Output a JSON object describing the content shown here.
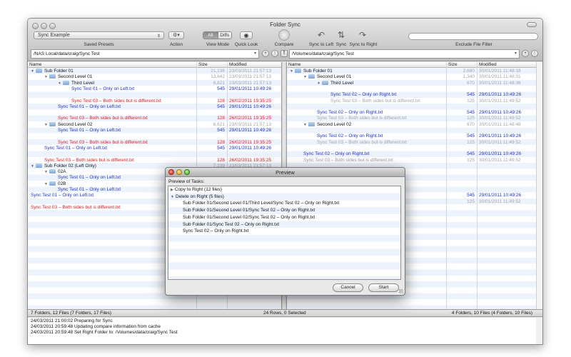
{
  "window": {
    "title": "Folder Sync"
  },
  "toolbar": {
    "preset_value": "Sync Example",
    "saved_presets_label": "Saved Presets",
    "action_label": "Action",
    "view_mode_label": "View Mode",
    "view_all": "All",
    "view_diffs": "Diffs",
    "quick_look_label": "Quick Look",
    "compare_label": "Compare",
    "sync_left_label": "Sync to Left",
    "sync_label": "Sync",
    "sync_right_label": "Sync to Right",
    "exclude_filter_label": "Exclude File Filter"
  },
  "left": {
    "path": "/NAS Local/data/craig/Sync Test",
    "col_name": "Name",
    "col_size": "Size",
    "col_modified": "Modified",
    "rows": [
      {
        "name": "Sub Folder 01",
        "size": "21,136",
        "mod": "23/03/2011 21:57:13",
        "indent": 0,
        "folder": true,
        "tri": "▼",
        "color": "c-black",
        "meta": "c-gray"
      },
      {
        "name": "Second Level 01",
        "size": "13,642",
        "mod": "23/03/2011 21:57:13",
        "indent": 1,
        "folder": true,
        "tri": "▼",
        "color": "c-black",
        "meta": "c-gray"
      },
      {
        "name": "Third Level",
        "size": "6,821",
        "mod": "23/03/2011 21:57:13",
        "indent": 2,
        "folder": true,
        "tri": "▼",
        "color": "c-black",
        "meta": "c-gray"
      },
      {
        "name": "Sync Test 01 – Only on Left.txt",
        "size": "545",
        "mod": "29/01/2011 10:49:26",
        "indent": 3,
        "color": "c-blue",
        "meta": "c-blue"
      },
      {
        "name": "",
        "size": "",
        "mod": "",
        "indent": 0
      },
      {
        "name": "Sync Test 03 – Both sides but is different.txt",
        "size": "128",
        "mod": "26/02/2011 19:35:25",
        "indent": 3,
        "color": "c-red",
        "meta": "c-red"
      },
      {
        "name": "Sync Test 01 – Only on Left.txt",
        "size": "545",
        "mod": "29/01/2011 10:49:26",
        "indent": 2,
        "color": "c-blue",
        "meta": "c-blue"
      },
      {
        "name": "",
        "size": "",
        "mod": "",
        "indent": 0
      },
      {
        "name": "Sync Test 03 – Both sides but is different.txt",
        "size": "128",
        "mod": "26/02/2011 19:35:25",
        "indent": 2,
        "color": "c-red",
        "meta": "c-red"
      },
      {
        "name": "Second Level 02",
        "size": "6,621",
        "mod": "23/03/2011 21:57:13",
        "indent": 1,
        "folder": true,
        "tri": "▼",
        "color": "c-black",
        "meta": "c-gray"
      },
      {
        "name": "Sync Test 01 – Only on Left.txt",
        "size": "545",
        "mod": "29/01/2011 10:49:26",
        "indent": 2,
        "color": "c-blue",
        "meta": "c-blue"
      },
      {
        "name": "",
        "size": "",
        "mod": "",
        "indent": 0
      },
      {
        "name": "Sync Test 03 – Both sides but is different.txt",
        "size": "128",
        "mod": "26/02/2011 19:35:25",
        "indent": 2,
        "color": "c-red",
        "meta": "c-red"
      },
      {
        "name": "Sync Test 01 – Only on Left.txt",
        "size": "545",
        "mod": "29/01/2011 10:49:26",
        "indent": 1,
        "color": "c-blue",
        "meta": "c-blue"
      },
      {
        "name": "",
        "size": "",
        "mod": "",
        "indent": 0
      },
      {
        "name": "Sync Test 03 – Both sides but is different.txt",
        "size": "128",
        "mod": "26/02/2011 19:35:25",
        "indent": 1,
        "color": "c-red",
        "meta": "c-red"
      },
      {
        "name": "Sub Folder 02 (Left Only)",
        "size": "7,239",
        "mod": "23/03/2011 21:57:13",
        "indent": 0,
        "folder": true,
        "tri": "▼",
        "color": "c-black",
        "meta": "c-gray"
      },
      {
        "name": "02A",
        "size": "",
        "mod": "",
        "indent": 1,
        "folder": true,
        "tri": "▼",
        "color": "c-black"
      },
      {
        "name": "Sync Test 01 – Only on Left.txt",
        "size": "",
        "mod": "",
        "indent": 2,
        "color": "c-blue"
      },
      {
        "name": "02B",
        "size": "",
        "mod": "",
        "indent": 1,
        "folder": true,
        "tri": "▼",
        "color": "c-black"
      },
      {
        "name": "Sync Test 01 – Only on Left.txt",
        "size": "",
        "mod": "",
        "indent": 2,
        "color": "c-blue"
      },
      {
        "name": "Sync Test 01 – Only on Left.txt",
        "size": "",
        "mod": "",
        "indent": 0,
        "color": "c-blue"
      },
      {
        "name": "",
        "size": "",
        "mod": "",
        "indent": 0
      },
      {
        "name": "Sync Test 03 – Both sides but is different.txt",
        "size": "",
        "mod": "",
        "indent": 0,
        "color": "c-red"
      }
    ]
  },
  "right": {
    "path": "/Volumes/data/craig/Sync Test",
    "col_name": "Name",
    "col_size": "Size",
    "col_modified": "Modified",
    "rows": [
      {
        "name": "Sub Folder 01",
        "size": "2,680",
        "mod": "30/01/2011 11:48:18",
        "indent": 0,
        "folder": true,
        "tri": "▼",
        "color": "c-black",
        "meta": "c-gray"
      },
      {
        "name": "Second Level 01",
        "size": "1,340",
        "mod": "30/01/2011 11:48:31",
        "indent": 1,
        "folder": true,
        "tri": "▼",
        "color": "c-black",
        "meta": "c-gray"
      },
      {
        "name": "Third Level",
        "size": "670",
        "mod": "30/01/2011 11:48:36",
        "indent": 2,
        "folder": true,
        "tri": "▼",
        "color": "c-black",
        "meta": "c-gray"
      },
      {
        "name": "",
        "size": "",
        "mod": "",
        "indent": 0
      },
      {
        "name": "Sync Test 02 – Only on Right.txt",
        "size": "545",
        "mod": "29/01/2011 10:49:26",
        "indent": 3,
        "color": "c-blue",
        "meta": "c-blue"
      },
      {
        "name": "Sync Test 03 – Both sides but is different.txt",
        "size": "125",
        "mod": "30/01/2011 11:49:52",
        "indent": 3,
        "color": "c-gray",
        "meta": "c-gray"
      },
      {
        "name": "",
        "size": "",
        "mod": "",
        "indent": 0
      },
      {
        "name": "Sync Test 02 – Only on Right.txt",
        "size": "545",
        "mod": "29/01/2011 10:49:26",
        "indent": 2,
        "color": "c-blue",
        "meta": "c-blue"
      },
      {
        "name": "Sync Test 03 – Both sides but is different.txt",
        "size": "125",
        "mod": "30/01/2011 11:49:52",
        "indent": 2,
        "color": "c-gray",
        "meta": "c-gray"
      },
      {
        "name": "Second Level 02",
        "size": "670",
        "mod": "30/01/2011 11:48:48",
        "indent": 1,
        "folder": true,
        "tri": "▼",
        "color": "c-black",
        "meta": "c-gray"
      },
      {
        "name": "",
        "size": "",
        "mod": "",
        "indent": 0
      },
      {
        "name": "Sync Test 02 – Only on Right.txt",
        "size": "545",
        "mod": "29/01/2011 10:49:26",
        "indent": 2,
        "color": "c-blue",
        "meta": "c-blue"
      },
      {
        "name": "Sync Test 03 – Both sides but is different.txt",
        "size": "125",
        "mod": "30/01/2011 11:49:52",
        "indent": 2,
        "color": "c-gray",
        "meta": "c-gray"
      },
      {
        "name": "",
        "size": "",
        "mod": "",
        "indent": 0
      },
      {
        "name": "Sync Test 02 – Only on Right.txt",
        "size": "545",
        "mod": "29/01/2011 10:49:26",
        "indent": 1,
        "color": "c-blue",
        "meta": "c-blue"
      },
      {
        "name": "Sync Test 03 – Both sides but is different.txt",
        "size": "125",
        "mod": "30/01/2011 11:49:52",
        "indent": 1,
        "color": "c-gray",
        "meta": "c-gray"
      },
      {
        "name": "",
        "size": "",
        "mod": "",
        "indent": 0
      },
      {
        "name": "",
        "size": "",
        "mod": "",
        "indent": 0
      },
      {
        "name": "",
        "size": "",
        "mod": "",
        "indent": 0
      },
      {
        "name": "",
        "size": "",
        "mod": "",
        "indent": 0
      },
      {
        "name": "",
        "size": "",
        "mod": "",
        "indent": 0
      },
      {
        "name": "",
        "size": "545",
        "mod": "29/01/2011 10:49:26",
        "indent": 0,
        "color": "c-blue",
        "meta": "c-blue"
      },
      {
        "name": "",
        "size": "125",
        "mod": "30/01/2011 11:49:52",
        "indent": 0,
        "color": "c-gray",
        "meta": "c-gray"
      }
    ]
  },
  "status": {
    "left": "7 Folders, 12 Files (7 Folders, 17 Files)",
    "center": "24 Rows, 0 Selected",
    "right": "4 Folders, 10 Files (4 Folders, 10 Files)"
  },
  "log": [
    "24/03/2011 21:00:02   Preparing for Sync",
    "24/03/2011 20:59:48   Updating compare information from cache",
    "24/03/2011 20:59:48   Set Right Folder to: /Volumes/data/craig/Sync Test"
  ],
  "preview": {
    "title": "Preview",
    "heading": "Preview of Tasks:",
    "items": [
      {
        "text": "Copy to Right (12 files)",
        "indent": 0,
        "tri": "▶"
      },
      {
        "text": "Delete on Right (5 files)",
        "indent": 0,
        "tri": "▼"
      },
      {
        "text": "Sub Folder 01/Second Level 01/Third Level/Sync Test 02 – Only on Right.txt",
        "indent": 1
      },
      {
        "text": "Sub Folder 01/Second Level 01/Sync Test 02 – Only on Right.txt",
        "indent": 1
      },
      {
        "text": "Sub Folder 01/Second Level 02/Sync Test 02 – Only on Right.txt",
        "indent": 1
      },
      {
        "text": "Sub Folder 01/Sync Test 02 – Only on Right.txt",
        "indent": 1
      },
      {
        "text": "Sync Test 02 – Only on Right.txt",
        "indent": 1
      }
    ],
    "cancel_label": "Cancel",
    "start_label": "Start"
  }
}
